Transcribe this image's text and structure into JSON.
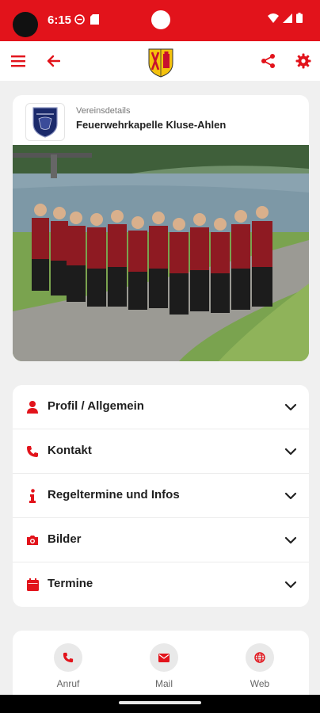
{
  "status_bar": {
    "time": "6:15"
  },
  "club": {
    "caption": "Vereinsdetails",
    "name": "Feuerwehrkapelle Kluse-Ahlen"
  },
  "menu": {
    "items": [
      {
        "label": "Profil / Allgemein",
        "icon": "user-icon"
      },
      {
        "label": "Kontakt",
        "icon": "phone-icon"
      },
      {
        "label": "Regeltermine und Infos",
        "icon": "info-icon"
      },
      {
        "label": "Bilder",
        "icon": "camera-icon"
      },
      {
        "label": "Termine",
        "icon": "calendar-icon"
      }
    ]
  },
  "actions": [
    {
      "label": "Anruf",
      "icon": "phone-icon"
    },
    {
      "label": "Mail",
      "icon": "mail-icon"
    },
    {
      "label": "Web",
      "icon": "globe-icon"
    }
  ],
  "colors": {
    "accent": "#e2131b",
    "background": "#f0f0f0"
  }
}
